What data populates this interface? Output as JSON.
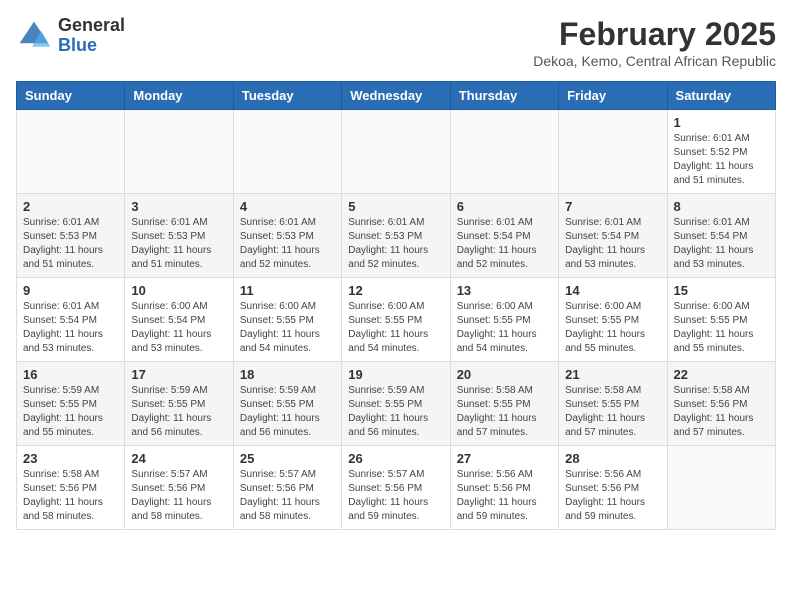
{
  "header": {
    "logo": {
      "general": "General",
      "blue": "Blue"
    },
    "title": "February 2025",
    "subtitle": "Dekoa, Kemo, Central African Republic"
  },
  "calendar": {
    "days_of_week": [
      "Sunday",
      "Monday",
      "Tuesday",
      "Wednesday",
      "Thursday",
      "Friday",
      "Saturday"
    ],
    "weeks": [
      [
        {
          "day": "",
          "info": ""
        },
        {
          "day": "",
          "info": ""
        },
        {
          "day": "",
          "info": ""
        },
        {
          "day": "",
          "info": ""
        },
        {
          "day": "",
          "info": ""
        },
        {
          "day": "",
          "info": ""
        },
        {
          "day": "1",
          "info": "Sunrise: 6:01 AM\nSunset: 5:52 PM\nDaylight: 11 hours and 51 minutes."
        }
      ],
      [
        {
          "day": "2",
          "info": "Sunrise: 6:01 AM\nSunset: 5:53 PM\nDaylight: 11 hours and 51 minutes."
        },
        {
          "day": "3",
          "info": "Sunrise: 6:01 AM\nSunset: 5:53 PM\nDaylight: 11 hours and 51 minutes."
        },
        {
          "day": "4",
          "info": "Sunrise: 6:01 AM\nSunset: 5:53 PM\nDaylight: 11 hours and 52 minutes."
        },
        {
          "day": "5",
          "info": "Sunrise: 6:01 AM\nSunset: 5:53 PM\nDaylight: 11 hours and 52 minutes."
        },
        {
          "day": "6",
          "info": "Sunrise: 6:01 AM\nSunset: 5:54 PM\nDaylight: 11 hours and 52 minutes."
        },
        {
          "day": "7",
          "info": "Sunrise: 6:01 AM\nSunset: 5:54 PM\nDaylight: 11 hours and 53 minutes."
        },
        {
          "day": "8",
          "info": "Sunrise: 6:01 AM\nSunset: 5:54 PM\nDaylight: 11 hours and 53 minutes."
        }
      ],
      [
        {
          "day": "9",
          "info": "Sunrise: 6:01 AM\nSunset: 5:54 PM\nDaylight: 11 hours and 53 minutes."
        },
        {
          "day": "10",
          "info": "Sunrise: 6:00 AM\nSunset: 5:54 PM\nDaylight: 11 hours and 53 minutes."
        },
        {
          "day": "11",
          "info": "Sunrise: 6:00 AM\nSunset: 5:55 PM\nDaylight: 11 hours and 54 minutes."
        },
        {
          "day": "12",
          "info": "Sunrise: 6:00 AM\nSunset: 5:55 PM\nDaylight: 11 hours and 54 minutes."
        },
        {
          "day": "13",
          "info": "Sunrise: 6:00 AM\nSunset: 5:55 PM\nDaylight: 11 hours and 54 minutes."
        },
        {
          "day": "14",
          "info": "Sunrise: 6:00 AM\nSunset: 5:55 PM\nDaylight: 11 hours and 55 minutes."
        },
        {
          "day": "15",
          "info": "Sunrise: 6:00 AM\nSunset: 5:55 PM\nDaylight: 11 hours and 55 minutes."
        }
      ],
      [
        {
          "day": "16",
          "info": "Sunrise: 5:59 AM\nSunset: 5:55 PM\nDaylight: 11 hours and 55 minutes."
        },
        {
          "day": "17",
          "info": "Sunrise: 5:59 AM\nSunset: 5:55 PM\nDaylight: 11 hours and 56 minutes."
        },
        {
          "day": "18",
          "info": "Sunrise: 5:59 AM\nSunset: 5:55 PM\nDaylight: 11 hours and 56 minutes."
        },
        {
          "day": "19",
          "info": "Sunrise: 5:59 AM\nSunset: 5:55 PM\nDaylight: 11 hours and 56 minutes."
        },
        {
          "day": "20",
          "info": "Sunrise: 5:58 AM\nSunset: 5:55 PM\nDaylight: 11 hours and 57 minutes."
        },
        {
          "day": "21",
          "info": "Sunrise: 5:58 AM\nSunset: 5:55 PM\nDaylight: 11 hours and 57 minutes."
        },
        {
          "day": "22",
          "info": "Sunrise: 5:58 AM\nSunset: 5:56 PM\nDaylight: 11 hours and 57 minutes."
        }
      ],
      [
        {
          "day": "23",
          "info": "Sunrise: 5:58 AM\nSunset: 5:56 PM\nDaylight: 11 hours and 58 minutes."
        },
        {
          "day": "24",
          "info": "Sunrise: 5:57 AM\nSunset: 5:56 PM\nDaylight: 11 hours and 58 minutes."
        },
        {
          "day": "25",
          "info": "Sunrise: 5:57 AM\nSunset: 5:56 PM\nDaylight: 11 hours and 58 minutes."
        },
        {
          "day": "26",
          "info": "Sunrise: 5:57 AM\nSunset: 5:56 PM\nDaylight: 11 hours and 59 minutes."
        },
        {
          "day": "27",
          "info": "Sunrise: 5:56 AM\nSunset: 5:56 PM\nDaylight: 11 hours and 59 minutes."
        },
        {
          "day": "28",
          "info": "Sunrise: 5:56 AM\nSunset: 5:56 PM\nDaylight: 11 hours and 59 minutes."
        },
        {
          "day": "",
          "info": ""
        }
      ]
    ]
  }
}
